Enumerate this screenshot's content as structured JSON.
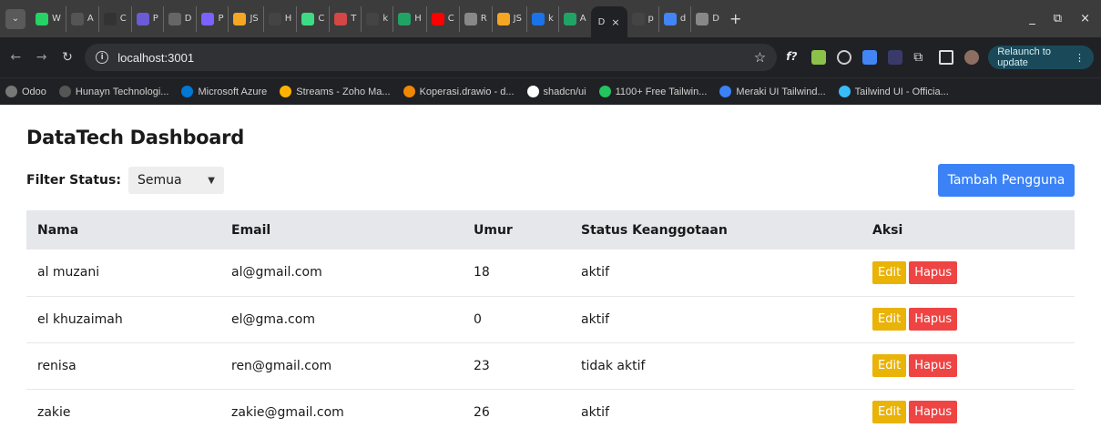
{
  "browser": {
    "tabs": [
      {
        "label": "W",
        "color": "#25d366"
      },
      {
        "label": "A",
        "color": "#555555",
        "prefix": "(A)"
      },
      {
        "label": "C",
        "color": "#333333",
        "prefix": "Mk"
      },
      {
        "label": "P",
        "color": "#6b5bd6"
      },
      {
        "label": "D",
        "color": "#666666"
      },
      {
        "label": "P",
        "color": "#7b61ff"
      },
      {
        "label": "JS",
        "color": "#f5a623"
      },
      {
        "label": "H",
        "color": "#444444"
      },
      {
        "label": "C",
        "color": "#3ddc84"
      },
      {
        "label": "T",
        "color": "#d34747"
      },
      {
        "label": "k",
        "color": "#444444"
      },
      {
        "label": "H",
        "color": "#21a366"
      },
      {
        "label": "C",
        "color": "#ff0000"
      },
      {
        "label": "R",
        "color": "#888888"
      },
      {
        "label": "JS",
        "color": "#f5a623"
      },
      {
        "label": "k",
        "color": "#1a73e8"
      },
      {
        "label": "A",
        "color": "#21a366"
      }
    ],
    "active_tab": {
      "label": "D",
      "close": "×"
    },
    "after_tabs": [
      {
        "label": "p",
        "color": "#444444"
      },
      {
        "label": "d",
        "color": "#4285f4"
      },
      {
        "label": "D",
        "color": "#888888"
      }
    ],
    "new_tab": "+",
    "window_controls": [
      "_",
      "⧉",
      "×"
    ],
    "address": "localhost:3001",
    "relaunch_label": "Relaunch to update",
    "bookmarks": [
      {
        "label": "Odoo",
        "color": "#777777"
      },
      {
        "label": "Hunayn Technologi...",
        "color": "#555555"
      },
      {
        "label": "Microsoft Azure",
        "color": "#0078d4"
      },
      {
        "label": "Streams - Zoho Ma...",
        "color": "#ffb300"
      },
      {
        "label": "Koperasi.drawio - d...",
        "color": "#f08705"
      },
      {
        "label": "shadcn/ui",
        "color": "#ffffff"
      },
      {
        "label": "1100+ Free Tailwin...",
        "color": "#22c55e"
      },
      {
        "label": "Meraki UI Tailwind...",
        "color": "#3b82f6"
      },
      {
        "label": "Tailwind UI - Officia...",
        "color": "#38bdf8"
      }
    ]
  },
  "page": {
    "title": "DataTech Dashboard",
    "filter_label": "Filter Status:",
    "filter_value": "Semua",
    "add_button": "Tambah Pengguna",
    "columns": [
      "Nama",
      "Email",
      "Umur",
      "Status Keanggotaan",
      "Aksi"
    ],
    "rows": [
      {
        "nama": "al muzani",
        "email": "al@gmail.com",
        "umur": "18",
        "status": "aktif"
      },
      {
        "nama": "el khuzaimah",
        "email": "el@gma.com",
        "umur": "0",
        "status": "aktif"
      },
      {
        "nama": "renisa",
        "email": "ren@gmail.com",
        "umur": "23",
        "status": "tidak aktif"
      },
      {
        "nama": "zakie",
        "email": "zakie@gmail.com",
        "umur": "26",
        "status": "aktif"
      }
    ],
    "edit_label": "Edit",
    "delete_label": "Hapus"
  }
}
